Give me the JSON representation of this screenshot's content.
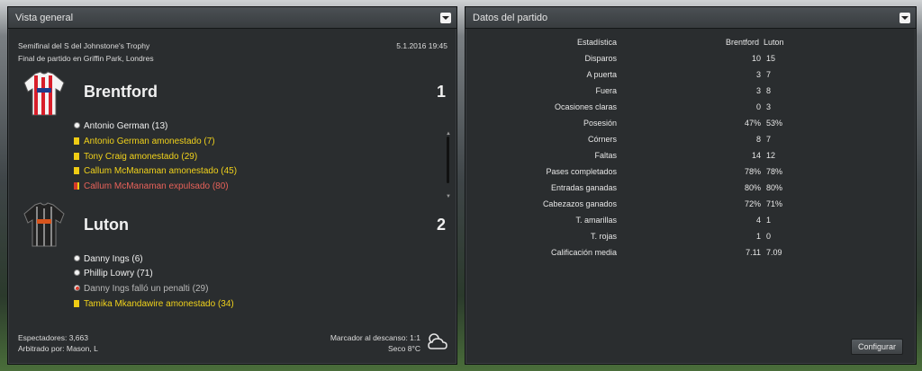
{
  "overview": {
    "title": "Vista general",
    "competition": "Semifinal del S del Johnstone's Trophy",
    "datetime": "5.1.2016 19:45",
    "venue": "Final de partido en Griffin Park, Londres",
    "home": {
      "name": "Brentford",
      "score": "1",
      "events": [
        {
          "type": "goal",
          "text": "Antonio German (13)"
        },
        {
          "type": "yellow",
          "text": "Antonio German amonestado (7)"
        },
        {
          "type": "yellow",
          "text": "Tony Craig amonestado (29)"
        },
        {
          "type": "yellow",
          "text": "Callum McManaman amonestado (45)"
        },
        {
          "type": "red",
          "text": "Callum McManaman expulsado (80)"
        }
      ]
    },
    "away": {
      "name": "Luton",
      "score": "2",
      "events": [
        {
          "type": "goal",
          "text": "Danny Ings (6)"
        },
        {
          "type": "goal",
          "text": "Phillip Lowry (71)"
        },
        {
          "type": "miss",
          "text": "Danny Ings falló un penalti (29)"
        },
        {
          "type": "yellow",
          "text": "Tamika Mkandawire amonestado (34)"
        }
      ]
    },
    "attendance": "Espectadores: 3,663",
    "referee": "Arbitrado por: Mason, L",
    "halftime": "Marcador al descanso: 1:1",
    "weather": "Seco 8°C"
  },
  "stats": {
    "title": "Datos del partido",
    "header": {
      "label": "Estadística",
      "home": "Brentford",
      "away": "Luton"
    },
    "rows": [
      {
        "label": "Disparos",
        "home": "10",
        "away": "15"
      },
      {
        "label": "A puerta",
        "home": "3",
        "away": "7"
      },
      {
        "label": "Fuera",
        "home": "3",
        "away": "8"
      },
      {
        "label": "Ocasiones claras",
        "home": "0",
        "away": "3"
      },
      {
        "label": "Posesión",
        "home": "47%",
        "away": "53%"
      },
      {
        "label": "Córners",
        "home": "8",
        "away": "7"
      },
      {
        "label": "Faltas",
        "home": "14",
        "away": "12"
      },
      {
        "label": "Pases completados",
        "home": "78%",
        "away": "78%"
      },
      {
        "label": "Entradas ganadas",
        "home": "80%",
        "away": "80%"
      },
      {
        "label": "Cabezazos ganados",
        "home": "72%",
        "away": "71%"
      },
      {
        "label": "T. amarillas",
        "home": "4",
        "away": "1"
      },
      {
        "label": "T. rojas",
        "home": "1",
        "away": "0"
      },
      {
        "label": "Calificación media",
        "home": "7.11",
        "away": "7.09"
      }
    ],
    "configure_label": "Configurar"
  },
  "colors": {
    "yellow_text": "#f1d21b",
    "red_text": "#e8625a",
    "panel_bg": "#2a2d2f"
  },
  "icons": {
    "home_kit": "shirt-red-white-stripes-icon",
    "away_kit": "shirt-black-white-stripes-icon",
    "weather": "partly-cloudy-icon"
  }
}
